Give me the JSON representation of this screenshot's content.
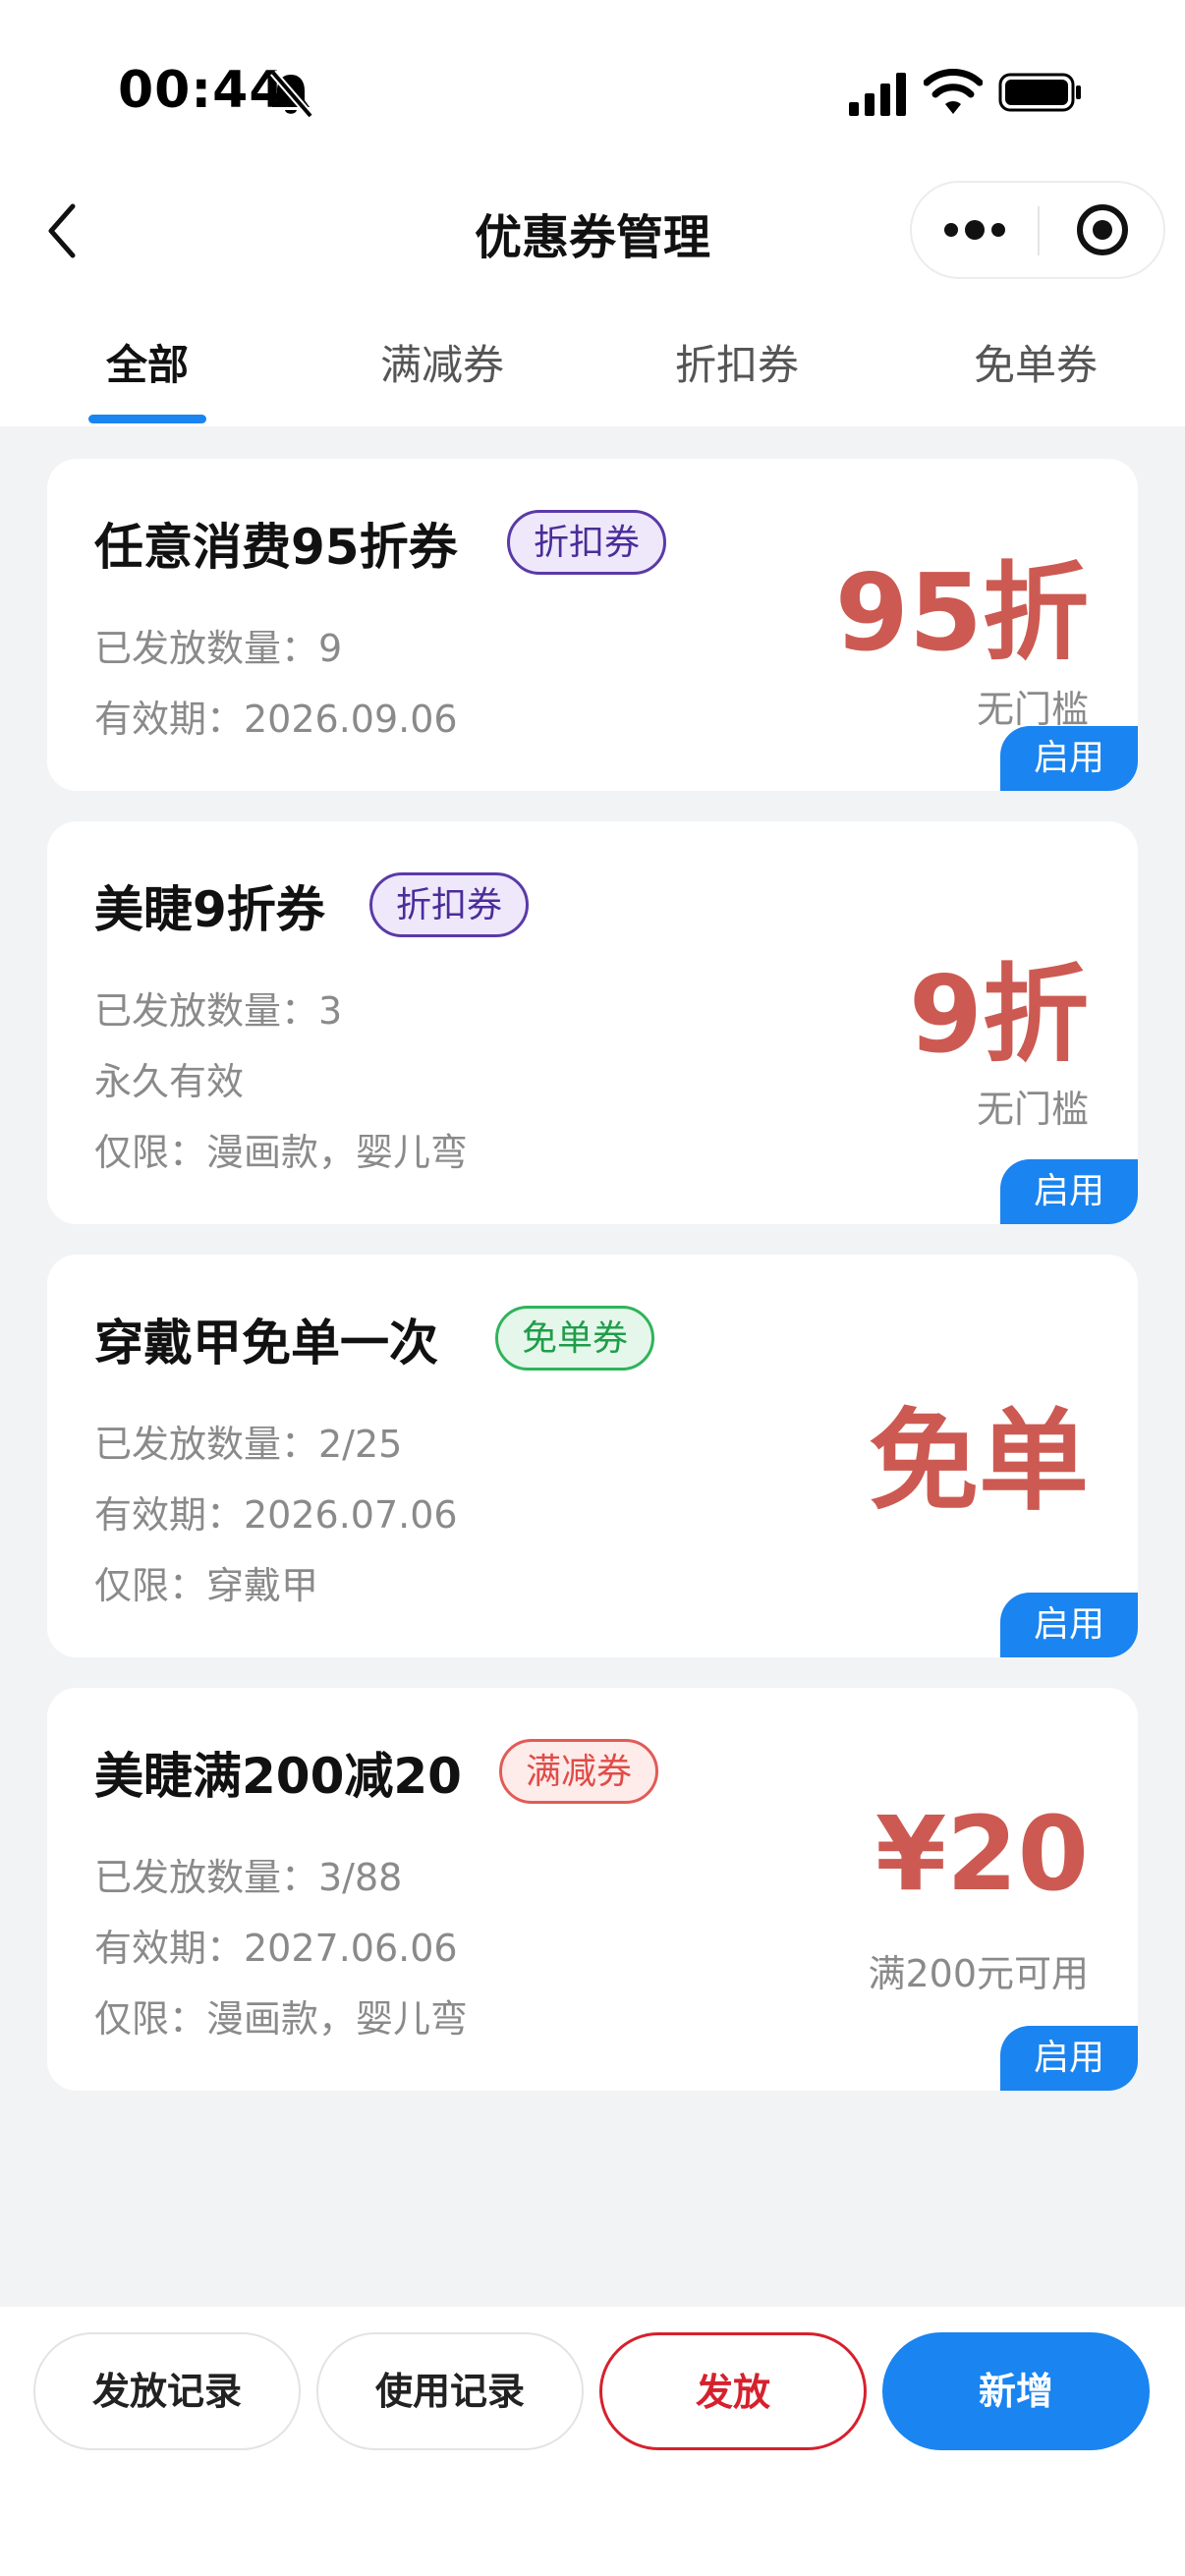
{
  "status": {
    "time": "00:44",
    "icons": [
      "bell-off-icon",
      "signal-icon",
      "wifi-icon",
      "battery-icon"
    ]
  },
  "nav": {
    "title": "优惠券管理",
    "icons": [
      "back-icon",
      "more-icon",
      "target-icon"
    ]
  },
  "tabs": [
    {
      "label": "全部",
      "active": true
    },
    {
      "label": "满减券",
      "active": false
    },
    {
      "label": "折扣券",
      "active": false
    },
    {
      "label": "免单券",
      "active": false
    }
  ],
  "coupons": [
    {
      "title": "任意消费95折券",
      "tag": "折扣券",
      "lines": [
        "已发放数量：9",
        "有效期：2026.09.06"
      ],
      "value": "95折",
      "sub": "无门槛",
      "action": "启用"
    },
    {
      "title": "美睫9折券",
      "tag": "折扣券",
      "lines": [
        "已发放数量：3",
        "永久有效",
        "仅限：漫画款，婴儿弯"
      ],
      "value": "9折",
      "sub": "无门槛",
      "action": "启用"
    },
    {
      "title": "穿戴甲免单一次",
      "tag": "免单券",
      "lines": [
        "已发放数量：2/25",
        "有效期：2026.07.06",
        "仅限：穿戴甲"
      ],
      "value": "免单",
      "sub": "",
      "action": "启用"
    },
    {
      "title": "美睫满200减20",
      "tag": "满减券",
      "lines": [
        "已发放数量：3/88",
        "有效期：2027.06.06",
        "仅限：漫画款，婴儿弯"
      ],
      "value": "¥20",
      "sub": "满200元可用",
      "action": "启用"
    }
  ],
  "actions": {
    "issue_records": "发放记录",
    "usage_records": "使用记录",
    "issue": "发放",
    "add_new": "新增"
  },
  "colors": {
    "accent": "#1a84f0",
    "value_red": "#cc5a52",
    "danger": "#d6212d",
    "discount_tag": "#5a3aa8",
    "free_tag": "#2fb35b",
    "reduce_tag": "#e25b57"
  }
}
